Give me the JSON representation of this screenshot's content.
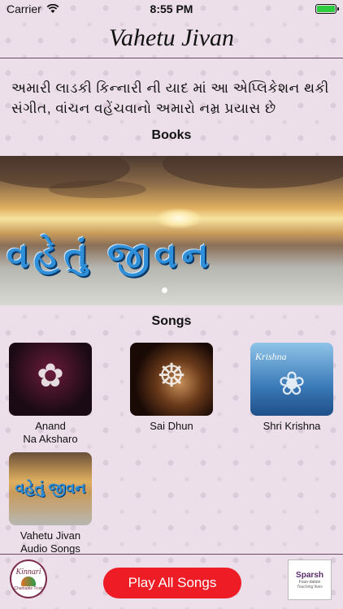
{
  "status_bar": {
    "carrier": "Carrier",
    "time": "8:55 PM"
  },
  "nav": {
    "title": "Vahetu Jivan"
  },
  "intro_text": "અમારી લાડકી કિન્નારી ની યાદ માં આ એપ્લિકેશન થકી સંગીત, વાંચન વહેંચવાનો અમારો નમ્ર પ્રયાસ છે",
  "books": {
    "heading": "Books",
    "banner_text": "વહેતું જીવન"
  },
  "songs": {
    "heading": "Songs",
    "items": [
      {
        "label": "Anand\nNa Aksharo",
        "icon": "radha-krishna-image"
      },
      {
        "label": "Sai Dhun",
        "icon": "sai-baba-image"
      },
      {
        "label": "Shri Krishna",
        "icon": "krishna-image",
        "caption": "Krishna"
      },
      {
        "label": "Vahetu Jivan\nAudio Songs",
        "icon": "vahetu-jivan-image",
        "caption": "વહેતું જીવન"
      }
    ]
  },
  "footer": {
    "left_logo_name": "Kinnari",
    "left_logo_sub": "Charitable Trust",
    "play_button": "Play All Songs",
    "right_logo_name": "Sparsh",
    "right_logo_sub": "Foun-dation",
    "right_logo_tag": "Touching lives"
  },
  "colors": {
    "accent": "#ee1c24",
    "background": "#ecdfe9"
  }
}
